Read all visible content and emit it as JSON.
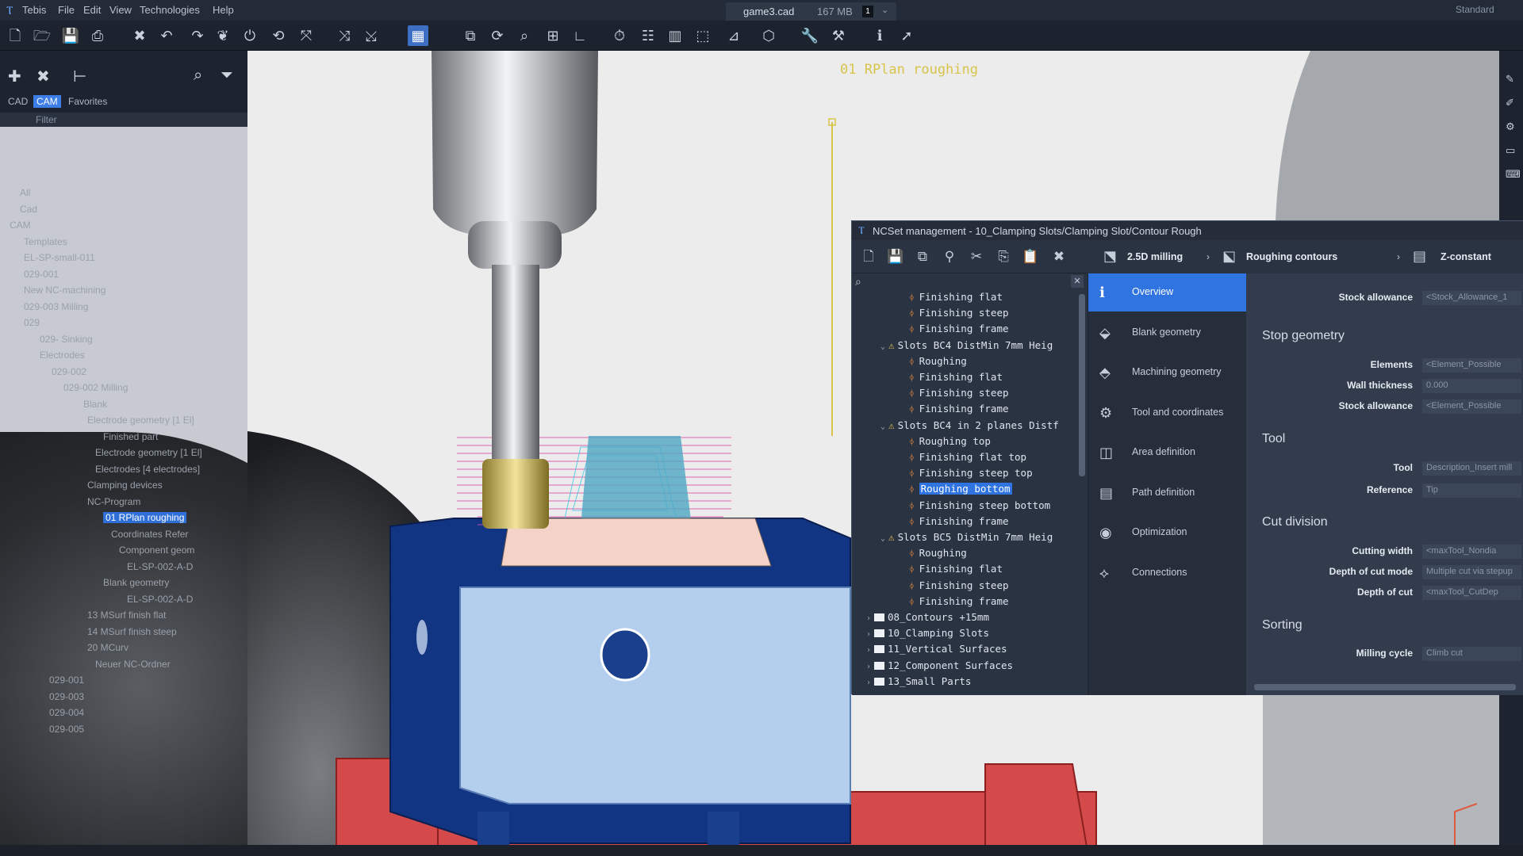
{
  "menubar": {
    "logo": "Ⲧ",
    "items": [
      "Tebis",
      "File",
      "Edit",
      "View",
      "Technologies",
      "Help"
    ],
    "doc_name": "game3.cad",
    "doc_size": "167 MB",
    "doc_badge": "1",
    "workspace": "Standard"
  },
  "left_panel": {
    "tabs": [
      "CAD",
      "CAM",
      "Favorites"
    ],
    "filter": "Filter",
    "tree": [
      "All",
      "Cad",
      "CAM",
      "Templates",
      "EL-SP-small-011",
      "029-001",
      "New NC-machining",
      "029-003 Milling",
      "029",
      "029- Sinking",
      "Electrodes",
      "029-002",
      "029-002 Milling",
      "Blank",
      "Electrode geometry [1 El]",
      "Finished part",
      "Electrode geometry [1 El]",
      "Electrodes [4 electrodes]",
      "Clamping devices",
      "NC-Program",
      "01 RPlan roughing",
      "Coordinates Refer",
      "Component geom",
      "EL-SP-002-A-D",
      "Blank geometry",
      "EL-SP-002-A-D",
      "13 MSurf finish flat",
      "14 MSurf finish steep",
      "20 MCurv",
      "Neuer NC-Ordner",
      "029-001",
      "029-003",
      "029-004",
      "029-005"
    ]
  },
  "viewport": {
    "label": "01 RPlan roughing"
  },
  "nc_panel": {
    "title": "NCSet management - 10_Clamping Slots/Clamping Slot/Contour Rough",
    "header": {
      "tab1": "2.5D milling",
      "tab2": "Roughing contours",
      "tab3": "Z-constant"
    },
    "tree": [
      "Finishing flat",
      "Finishing steep",
      "Finishing frame",
      "Slots BC4 DistMin 7mm Heig",
      "Roughing",
      "Finishing flat",
      "Finishing steep",
      "Finishing frame",
      "Slots BC4 in 2 planes Distf",
      "Roughing top",
      "Finishing flat top",
      "Finishing steep top",
      "Roughing bottom",
      "Finishing steep bottom",
      "Finishing frame",
      "Slots BC5 DistMin 7mm Heig",
      "Roughing",
      "Finishing flat",
      "Finishing steep",
      "Finishing frame",
      "08_Contours +15mm",
      "10_Clamping Slots",
      "11_Vertical Surfaces",
      "12_Component Surfaces",
      "13_Small Parts"
    ],
    "menu": [
      "Overview",
      "Blank geometry",
      "Machining geometry",
      "Tool and coordinates",
      "Area definition",
      "Path definition",
      "Optimization",
      "Connections"
    ],
    "props": {
      "stock_allowance_top_label": "Stock allowance",
      "stock_allowance_top_value": "<Stock_Allowance_1",
      "stop_geometry": "Stop geometry",
      "elements_label": "Elements",
      "elements_value": "<Element_Possible",
      "wall_label": "Wall thickness",
      "wall_value": "0.000",
      "stock_label": "Stock allowance",
      "stock_value": "<Element_Possible",
      "tool": "Tool",
      "tool_label": "Tool",
      "tool_value": "Description_Insert mill",
      "ref_label": "Reference",
      "ref_value": "Tip",
      "cut_division": "Cut division",
      "cw_label": "Cutting width",
      "cw_value": "<maxTool_Nondia",
      "doc_mode_label": "Depth of cut mode",
      "doc_mode_value": "Multiple cut via stepup",
      "doc_label": "Depth of cut",
      "doc_value": "<maxTool_CutDep",
      "sorting": "Sorting",
      "mc_label": "Milling cycle",
      "mc_value": "Climb cut"
    }
  }
}
